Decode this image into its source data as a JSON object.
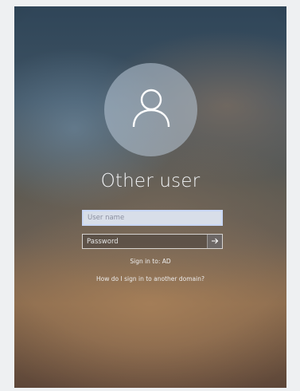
{
  "login": {
    "title": "Other user",
    "username_placeholder": "User name",
    "password_placeholder": "Password",
    "sign_in_to": "Sign in to: AD",
    "help_link": "How do I sign in to another domain?"
  },
  "icons": {
    "avatar": "user-icon",
    "submit": "arrow-right-icon"
  },
  "colors": {
    "text": "#f3f5f7",
    "avatar_circle": "#b9c8d7"
  }
}
